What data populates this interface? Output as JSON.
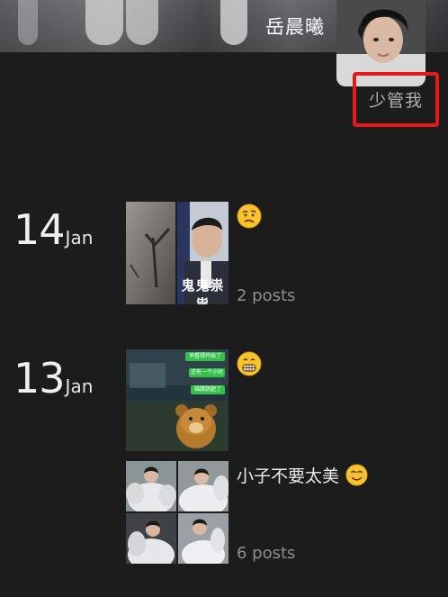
{
  "profile": {
    "username": "岳晨曦",
    "bio": "少管我",
    "avatar_icon": "profile-photo"
  },
  "entries": [
    {
      "day": "14",
      "month": "Jan",
      "caption_emoji": "confused-face",
      "posts_count": "2 posts",
      "thumbnail_text": "鬼鬼祟祟"
    },
    {
      "day": "13",
      "month": "Jan",
      "caption_emoji": "grimacing-face",
      "chat_bubbles": [
        "早看得开始了",
        "还有一个小时",
        "福腊肠肥了"
      ],
      "caption2": "小子不要太美",
      "caption2_emoji": "smiling-face",
      "posts_count": "6 posts"
    }
  ],
  "colors": {
    "background": "#1c1c1c",
    "highlight_border": "#e5191b",
    "muted_text": "#8e8e8e"
  }
}
